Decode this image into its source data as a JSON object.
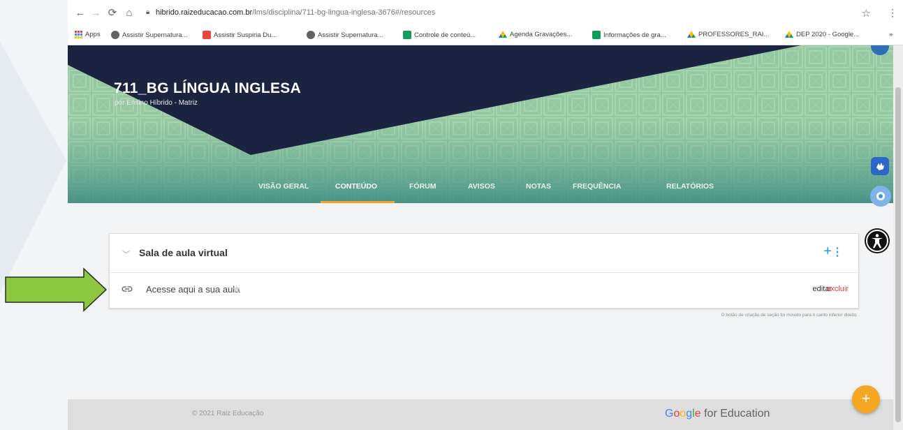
{
  "browser": {
    "url_host": "hibrido.raizeducacao.com.br",
    "url_path": "/lms/disciplina/711-bg-lingua-inglesa-3676#/resources",
    "bookmarks": [
      {
        "label": "Apps",
        "color": "#ea4335"
      },
      {
        "label": "Assistir Supernatura...",
        "color": "#5f6368"
      },
      {
        "label": "Assistir Suspiria Du...",
        "color": "#e8453c"
      },
      {
        "label": "Assistir Supernatura...",
        "color": "#5f6368"
      },
      {
        "label": "Controle de conteú...",
        "color": "#0f9d58"
      },
      {
        "label": "Agenda Gravações...",
        "color": "#fbbc04"
      },
      {
        "label": "Informações de gra...",
        "color": "#0f9d58"
      },
      {
        "label": "PROFESSORES_RAI...",
        "color": "#fbbc04"
      },
      {
        "label": "DEP 2020 - Google...",
        "color": "#fbbc04"
      }
    ],
    "more_bookmarks": "»"
  },
  "course": {
    "title": "711_BG LÍNGUA INGLESA",
    "subtitle": "por Ensino Híbrido - Matriz"
  },
  "tabs": [
    {
      "label": "VISÃO GERAL"
    },
    {
      "label": "CONTEÚDO"
    },
    {
      "label": "FÓRUM"
    },
    {
      "label": "AVISOS"
    },
    {
      "label": "NOTAS"
    },
    {
      "label": "FREQUÊNCIA"
    },
    {
      "label": "RELATÓRIOS"
    }
  ],
  "active_tab": "CONTEÚDO",
  "section": {
    "title": "Sala de aula virtual",
    "item_label": "Acesse aqui a sua aula",
    "edit_label": "editar",
    "delete_label": "excluir"
  },
  "hint": "O botão de criação de seção foi movido para o canto inferior direito.",
  "footer": {
    "copyright": "© 2021 Raiz Educação",
    "google": "Google",
    "for_education": "for Education"
  },
  "fab_label": "+",
  "colors": {
    "accent": "#f5a623",
    "banner_green": "#8fc4a0",
    "banner_navy": "#1c2340",
    "link_blue": "#2196f3",
    "delete_red": "#e53935",
    "arrow_green": "#8dc63f"
  }
}
